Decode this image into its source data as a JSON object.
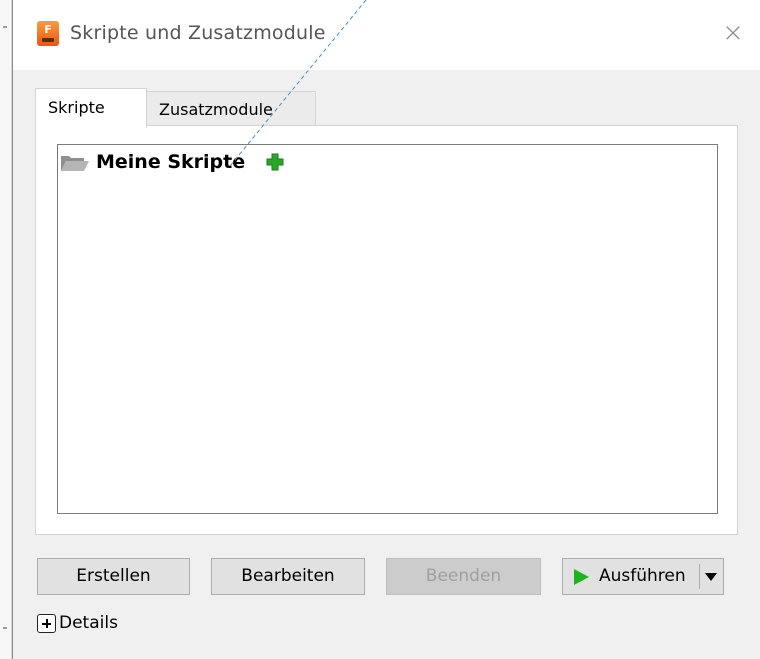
{
  "window": {
    "title": "Skripte und Zusatzmodule",
    "close_glyph": "×",
    "app_icon_letter": "F"
  },
  "tabs": [
    {
      "label": "Skripte",
      "active": true
    },
    {
      "label": "Zusatzmodule",
      "active": false
    }
  ],
  "tree": {
    "root": {
      "label": "Meine Skripte",
      "icon": "open-folder-icon",
      "action_icon": "add-icon"
    }
  },
  "buttons": {
    "create": "Erstellen",
    "edit": "Bearbeiten",
    "stop": "Beenden",
    "run": "Ausführen"
  },
  "details": {
    "label": "Details"
  },
  "colors": {
    "accent_orange": "#f07c2c",
    "run_green": "#1db31d",
    "add_green": "#2aa52a",
    "dialog_bg": "#f0f0f0"
  }
}
